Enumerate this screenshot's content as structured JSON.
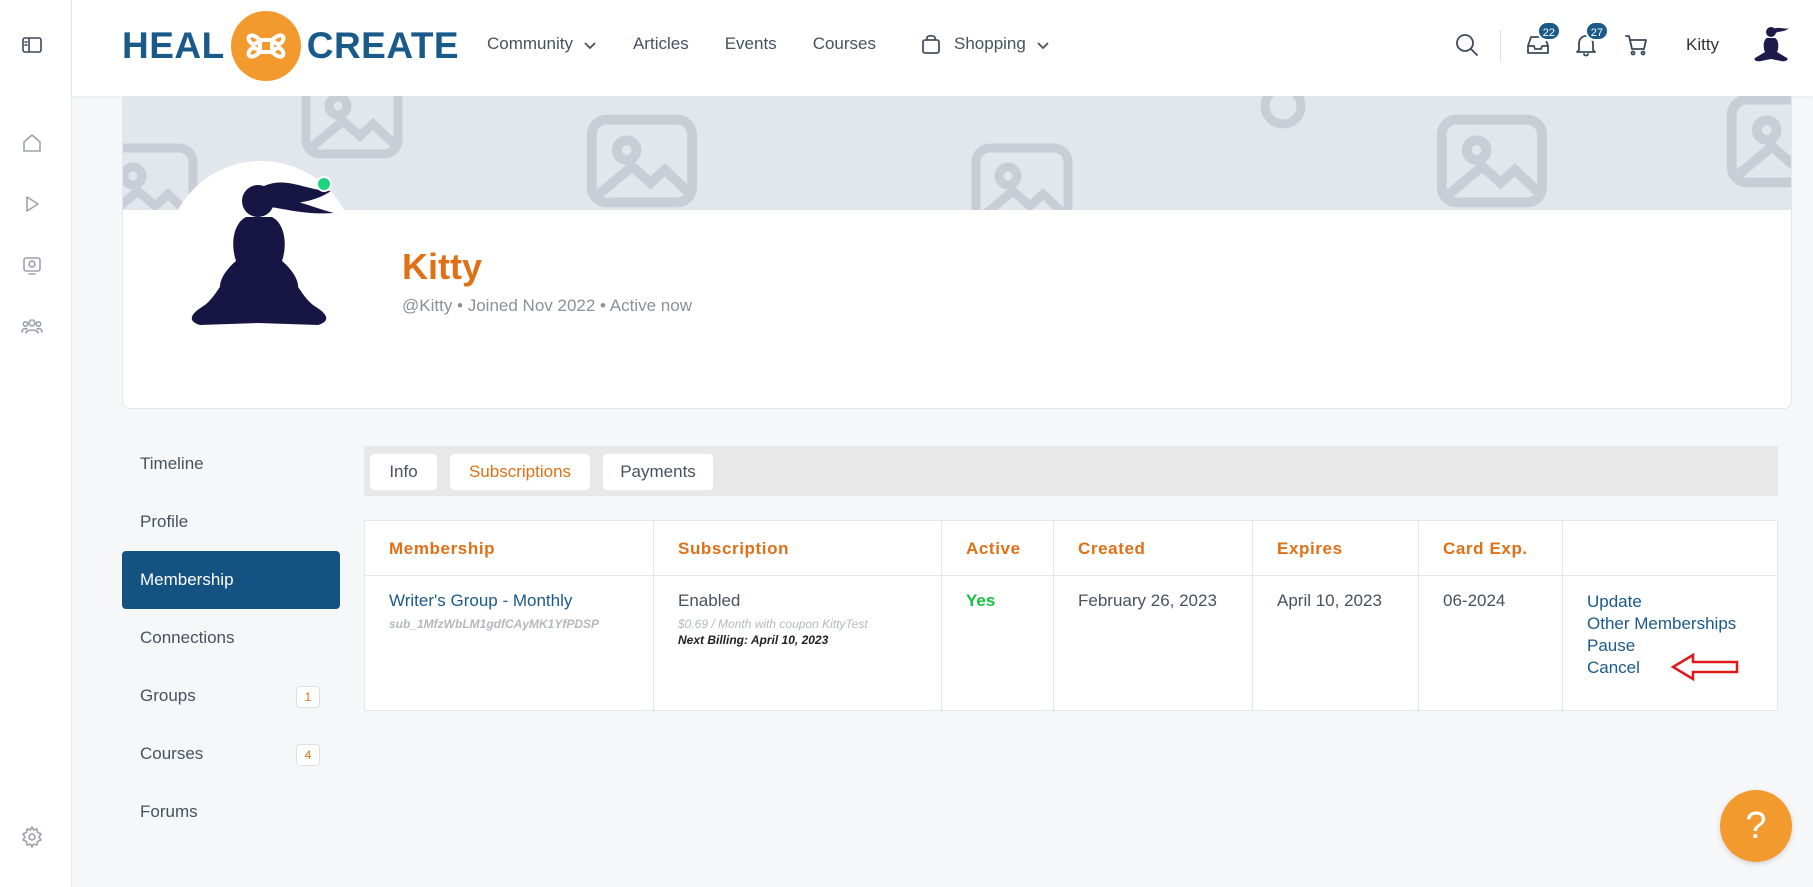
{
  "brand": {
    "left_word": "HEAL",
    "right_word": "CREATE",
    "accent": "#f39a2e",
    "primary": "#1a5a8a"
  },
  "nav": {
    "community": "Community",
    "articles": "Articles",
    "events": "Events",
    "courses": "Courses",
    "shopping": "Shopping"
  },
  "header": {
    "messages_count": "22",
    "notifications_count": "27",
    "user_name": "Kitty"
  },
  "profile": {
    "name": "Kitty",
    "meta": "@Kitty • Joined Nov 2022 • Active now"
  },
  "sidebar": {
    "items": [
      {
        "label": "Timeline"
      },
      {
        "label": "Profile"
      },
      {
        "label": "Membership"
      },
      {
        "label": "Connections"
      },
      {
        "label": "Groups",
        "count": "1"
      },
      {
        "label": "Courses",
        "count": "4"
      },
      {
        "label": "Forums"
      }
    ]
  },
  "tabs": {
    "info": "Info",
    "subscriptions": "Subscriptions",
    "payments": "Payments"
  },
  "table": {
    "headers": {
      "membership": "Membership",
      "subscription": "Subscription",
      "active": "Active",
      "created": "Created",
      "expires": "Expires",
      "card_exp": "Card Exp."
    },
    "row": {
      "membership_name": "Writer's Group - Monthly",
      "membership_id": "sub_1MfzWbLM1gdfCAyMK1YfPDSP",
      "subscription_status": "Enabled",
      "subscription_price": "$0.69 / Month with coupon KittyTest",
      "next_billing": "Next Billing: April 10, 2023",
      "active": "Yes",
      "created": "February 26, 2023",
      "expires": "April 10, 2023",
      "card_exp": "06-2024",
      "actions": {
        "update": "Update",
        "other": "Other Memberships",
        "pause": "Pause",
        "cancel": "Cancel"
      }
    }
  },
  "help_label": "?"
}
